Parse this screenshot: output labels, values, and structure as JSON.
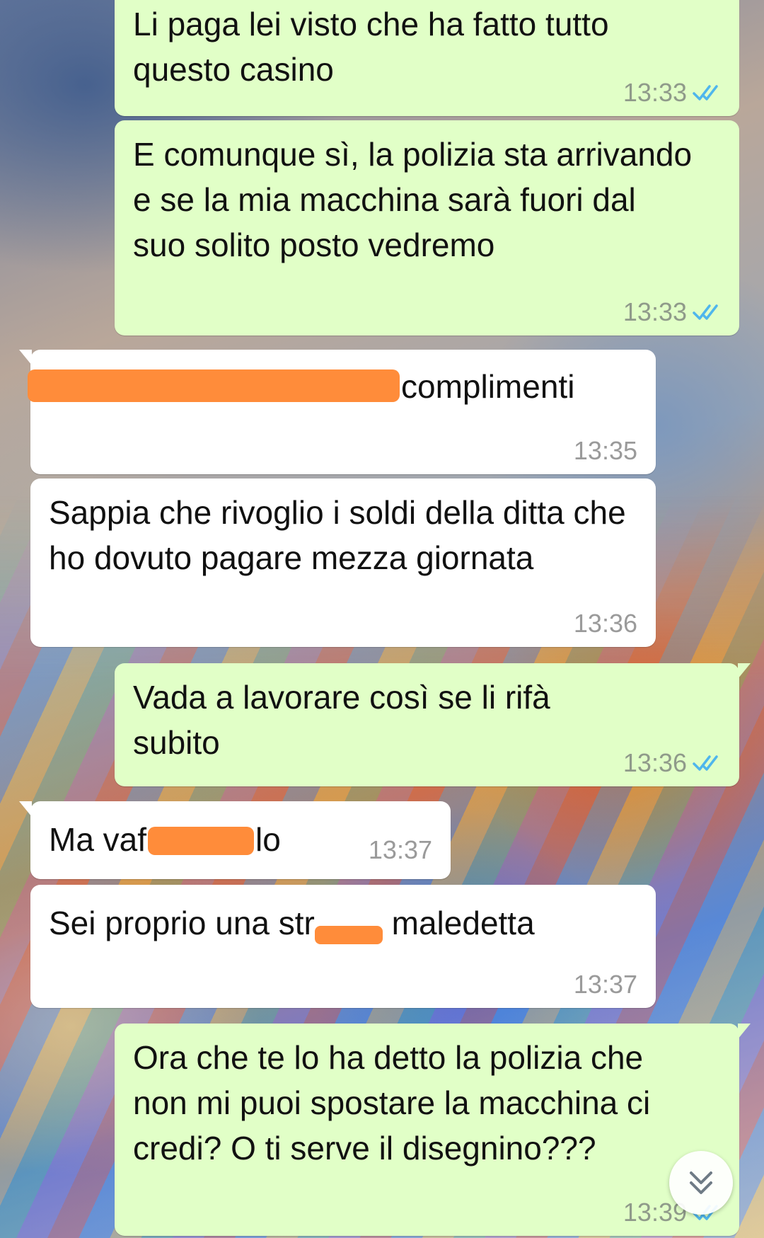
{
  "chat": {
    "messages": [
      {
        "direction": "outgoing",
        "text": "Li paga lei visto che ha fatto tutto questo casino",
        "time": "13:33",
        "status": "read"
      },
      {
        "direction": "outgoing",
        "text": "E comunque sì, la polizia sta arrivando e se la mia macchina sarà fuori dal suo solito posto vedremo",
        "time": "13:33",
        "status": "read"
      },
      {
        "direction": "incoming",
        "text": "complimenti",
        "time": "13:35",
        "redacted": true
      },
      {
        "direction": "incoming",
        "text": "Sappia che rivoglio i soldi della ditta che ho dovuto pagare mezza giornata",
        "time": "13:36"
      },
      {
        "direction": "outgoing",
        "text": "Vada a lavorare così se li rifà subito",
        "time": "13:36",
        "status": "read"
      },
      {
        "direction": "incoming",
        "text_before": "Ma vaf",
        "text_after": "lo",
        "time": "13:37",
        "redacted": true
      },
      {
        "direction": "incoming",
        "text_before": "Sei proprio una str",
        "text_after": " maledetta",
        "time": "13:37",
        "redacted": true
      },
      {
        "direction": "outgoing",
        "text": "Ora che te lo ha detto la polizia che non mi puoi spostare la macchina ci credi? O ti serve il disegnino???",
        "time": "13:39",
        "status": "read"
      }
    ]
  },
  "icons": {
    "read_receipt": "double-check-icon",
    "scroll_down": "chevron-double-down-icon"
  },
  "colors": {
    "outgoing_bubble": "#e1ffc7",
    "incoming_bubble": "#ffffff",
    "read_tick": "#4fb6ec",
    "redaction": "#ff8c3a"
  }
}
